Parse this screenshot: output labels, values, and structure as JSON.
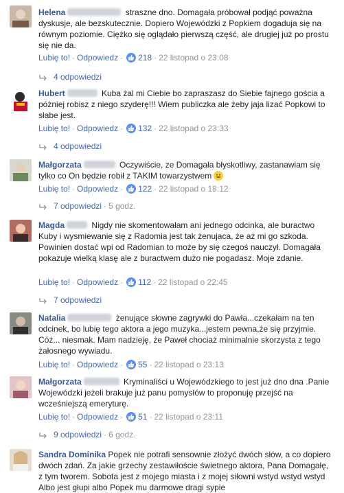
{
  "labels": {
    "like": "Lubię to!",
    "reply": "Odpowiedz",
    "separator": "·"
  },
  "comments": [
    {
      "author": "Helena",
      "text": "straszne dno. Domagała próbował podjąć poważna dyskusje, ale bezskutecznie. Dopiero Wojewódzki z Popkiem dogaduja się na równym poziomie. Ciężko się oglądało pierwszą część, ale drugiej już po prostu się nie da.",
      "likes": "218",
      "time": "22 listopad o 23:08",
      "replies": "4 odpowiedzi",
      "replies_time": "",
      "emoji": ""
    },
    {
      "author": "Hubert",
      "text": "Kuba żal mi Ciebie bo zapraszasz do Siebie fajnego gościa a póżniej robisz z niego szyderę!!! Wiem publiczka ale żeby jaja lizać Popkowi to słabe jest.",
      "likes": "132",
      "time": "22 listopad o 23:33",
      "replies": "4 odpowiedzi",
      "replies_time": "",
      "emoji": ""
    },
    {
      "author": "Małgorzata",
      "text": "Oczywiście, ze Domagała błyskotliwy, zastanawiam się tylko co On będzie robił z TAKIM towarzystwem",
      "likes": "122",
      "time": "22 listopad o 18:12",
      "replies": "7 odpowiedzi",
      "replies_time": "5 godz.",
      "emoji": "smiley-emoji"
    },
    {
      "author": "Magda",
      "text": "Nigdy nie skomentowałam ani jednego odcinka, ale buractwo Kuby i wysmiewanie się z Radomia jest tak żenujaca, że aż mi go szkoda. Powinien dostać wpi od Radomian to może by się czegoś nauczył. Domagała pokazuje wielką klasę ale z buractwem dużo nie pogadasz. Moje zdanie.",
      "likes": "112",
      "time": "22 listopad o 22:45",
      "replies": "7 odpowiedzi",
      "replies_time": "",
      "emoji": ""
    },
    {
      "author": "Natalia",
      "text": "żenujące słowne zagrywki do Pawła...czekałam na ten odcinek, bo lubię tego aktora a jego muzyka...jestem pewna,że się przyjmie. Cóż... niesmak. Mam nadzieję, że Paweł chociaż minimalnie skorzysta z tego żałosnego wywiadu.",
      "likes": "55",
      "time": "22 listopad o 23:13",
      "replies": "",
      "replies_time": "",
      "emoji": ""
    },
    {
      "author": "Małgorzata",
      "text": "Kryminaliści u Wojewódzkiego to jest już dno dna .Panie Wojewódzki jeżeli brakuje już panu pomysłów to proponuję przejść na wcześniejszą emeryturę.",
      "likes": "51",
      "time": "22 listopad o 23:11",
      "replies": "9 odpowiedzi",
      "replies_time": "6 godz.",
      "emoji": ""
    },
    {
      "author": "Sandra Dominika",
      "text": "Popek nie potrafi sensownie złożyć dwóch słów, a co dopiero dwóch zdań. Za jakie grzechy zestawiłoście świetnego aktora, Pana Domagałę, z tym tworem. Sobota jest z mojego miasta i z mojej siłowni wstyd wstyd wstyd Albo jest głupi albo Popek mu darmowe dragi sypie",
      "likes": "",
      "time": "",
      "replies": "",
      "replies_time": "",
      "emoji": ""
    }
  ],
  "colors": {
    "link": "#4267b2",
    "author": "#365899",
    "meta": "#90949c",
    "like_badge": "#5890ff"
  }
}
